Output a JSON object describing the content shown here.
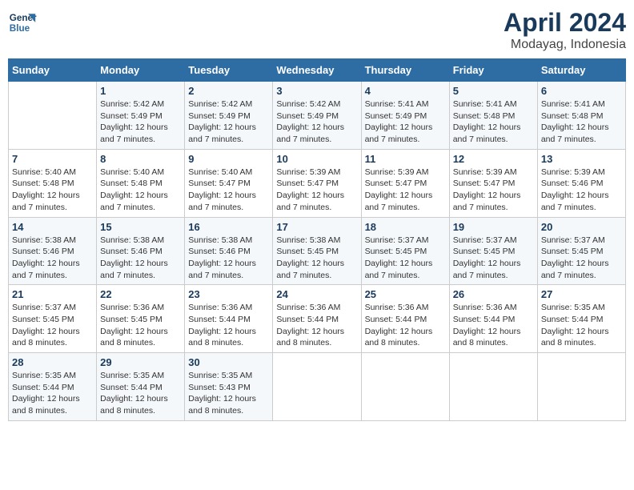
{
  "header": {
    "logo_line1": "General",
    "logo_line2": "Blue",
    "title": "April 2024",
    "subtitle": "Modayag, Indonesia"
  },
  "calendar": {
    "days_of_week": [
      "Sunday",
      "Monday",
      "Tuesday",
      "Wednesday",
      "Thursday",
      "Friday",
      "Saturday"
    ],
    "weeks": [
      [
        {
          "day": "",
          "info": ""
        },
        {
          "day": "1",
          "info": "Sunrise: 5:42 AM\nSunset: 5:49 PM\nDaylight: 12 hours\nand 7 minutes."
        },
        {
          "day": "2",
          "info": "Sunrise: 5:42 AM\nSunset: 5:49 PM\nDaylight: 12 hours\nand 7 minutes."
        },
        {
          "day": "3",
          "info": "Sunrise: 5:42 AM\nSunset: 5:49 PM\nDaylight: 12 hours\nand 7 minutes."
        },
        {
          "day": "4",
          "info": "Sunrise: 5:41 AM\nSunset: 5:49 PM\nDaylight: 12 hours\nand 7 minutes."
        },
        {
          "day": "5",
          "info": "Sunrise: 5:41 AM\nSunset: 5:48 PM\nDaylight: 12 hours\nand 7 minutes."
        },
        {
          "day": "6",
          "info": "Sunrise: 5:41 AM\nSunset: 5:48 PM\nDaylight: 12 hours\nand 7 minutes."
        }
      ],
      [
        {
          "day": "7",
          "info": "Sunrise: 5:40 AM\nSunset: 5:48 PM\nDaylight: 12 hours\nand 7 minutes."
        },
        {
          "day": "8",
          "info": "Sunrise: 5:40 AM\nSunset: 5:48 PM\nDaylight: 12 hours\nand 7 minutes."
        },
        {
          "day": "9",
          "info": "Sunrise: 5:40 AM\nSunset: 5:47 PM\nDaylight: 12 hours\nand 7 minutes."
        },
        {
          "day": "10",
          "info": "Sunrise: 5:39 AM\nSunset: 5:47 PM\nDaylight: 12 hours\nand 7 minutes."
        },
        {
          "day": "11",
          "info": "Sunrise: 5:39 AM\nSunset: 5:47 PM\nDaylight: 12 hours\nand 7 minutes."
        },
        {
          "day": "12",
          "info": "Sunrise: 5:39 AM\nSunset: 5:47 PM\nDaylight: 12 hours\nand 7 minutes."
        },
        {
          "day": "13",
          "info": "Sunrise: 5:39 AM\nSunset: 5:46 PM\nDaylight: 12 hours\nand 7 minutes."
        }
      ],
      [
        {
          "day": "14",
          "info": "Sunrise: 5:38 AM\nSunset: 5:46 PM\nDaylight: 12 hours\nand 7 minutes."
        },
        {
          "day": "15",
          "info": "Sunrise: 5:38 AM\nSunset: 5:46 PM\nDaylight: 12 hours\nand 7 minutes."
        },
        {
          "day": "16",
          "info": "Sunrise: 5:38 AM\nSunset: 5:46 PM\nDaylight: 12 hours\nand 7 minutes."
        },
        {
          "day": "17",
          "info": "Sunrise: 5:38 AM\nSunset: 5:45 PM\nDaylight: 12 hours\nand 7 minutes."
        },
        {
          "day": "18",
          "info": "Sunrise: 5:37 AM\nSunset: 5:45 PM\nDaylight: 12 hours\nand 7 minutes."
        },
        {
          "day": "19",
          "info": "Sunrise: 5:37 AM\nSunset: 5:45 PM\nDaylight: 12 hours\nand 7 minutes."
        },
        {
          "day": "20",
          "info": "Sunrise: 5:37 AM\nSunset: 5:45 PM\nDaylight: 12 hours\nand 7 minutes."
        }
      ],
      [
        {
          "day": "21",
          "info": "Sunrise: 5:37 AM\nSunset: 5:45 PM\nDaylight: 12 hours\nand 8 minutes."
        },
        {
          "day": "22",
          "info": "Sunrise: 5:36 AM\nSunset: 5:45 PM\nDaylight: 12 hours\nand 8 minutes."
        },
        {
          "day": "23",
          "info": "Sunrise: 5:36 AM\nSunset: 5:44 PM\nDaylight: 12 hours\nand 8 minutes."
        },
        {
          "day": "24",
          "info": "Sunrise: 5:36 AM\nSunset: 5:44 PM\nDaylight: 12 hours\nand 8 minutes."
        },
        {
          "day": "25",
          "info": "Sunrise: 5:36 AM\nSunset: 5:44 PM\nDaylight: 12 hours\nand 8 minutes."
        },
        {
          "day": "26",
          "info": "Sunrise: 5:36 AM\nSunset: 5:44 PM\nDaylight: 12 hours\nand 8 minutes."
        },
        {
          "day": "27",
          "info": "Sunrise: 5:35 AM\nSunset: 5:44 PM\nDaylight: 12 hours\nand 8 minutes."
        }
      ],
      [
        {
          "day": "28",
          "info": "Sunrise: 5:35 AM\nSunset: 5:44 PM\nDaylight: 12 hours\nand 8 minutes."
        },
        {
          "day": "29",
          "info": "Sunrise: 5:35 AM\nSunset: 5:44 PM\nDaylight: 12 hours\nand 8 minutes."
        },
        {
          "day": "30",
          "info": "Sunrise: 5:35 AM\nSunset: 5:43 PM\nDaylight: 12 hours\nand 8 minutes."
        },
        {
          "day": "",
          "info": ""
        },
        {
          "day": "",
          "info": ""
        },
        {
          "day": "",
          "info": ""
        },
        {
          "day": "",
          "info": ""
        }
      ]
    ]
  }
}
